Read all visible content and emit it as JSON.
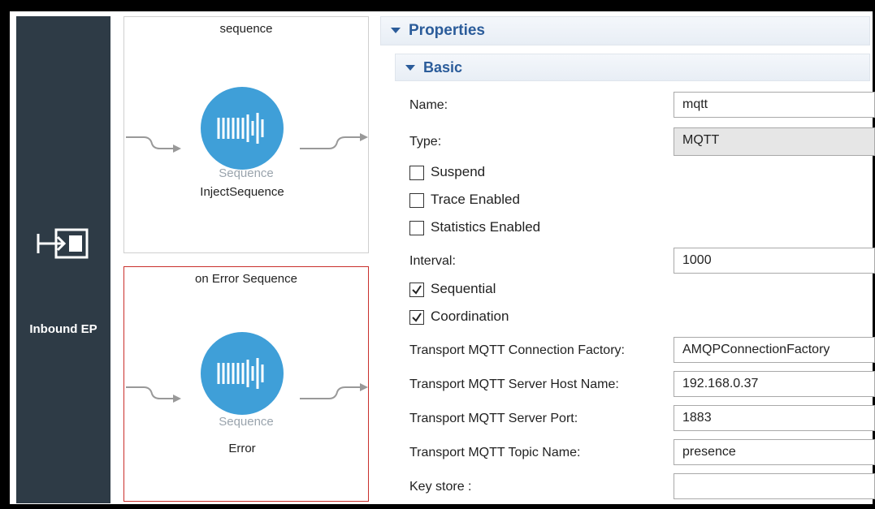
{
  "inbound": {
    "label": "Inbound EP",
    "icon": "inbound-endpoint-icon"
  },
  "sequence": {
    "title": "sequence",
    "type_label": "Sequence",
    "name": "InjectSequence",
    "icon": "sequence-icon"
  },
  "error_sequence": {
    "title": "on Error Sequence",
    "type_label": "Sequence",
    "name": "Error",
    "icon": "sequence-icon"
  },
  "properties": {
    "title": "Properties",
    "basic": {
      "title": "Basic"
    },
    "name": {
      "label": "Name:",
      "value": "mqtt"
    },
    "type": {
      "label": "Type:",
      "value": "MQTT"
    },
    "suspend": {
      "label": "Suspend",
      "checked": false
    },
    "trace": {
      "label": "Trace Enabled",
      "checked": false
    },
    "statistics": {
      "label": "Statistics Enabled",
      "checked": false
    },
    "interval": {
      "label": "Interval:",
      "value": "1000"
    },
    "sequential": {
      "label": "Sequential",
      "checked": true
    },
    "coordination": {
      "label": "Coordination",
      "checked": true
    },
    "connection_factory": {
      "label": "Transport MQTT Connection Factory:",
      "value": "AMQPConnectionFactory"
    },
    "server_host": {
      "label": "Transport MQTT Server Host Name:",
      "value": "192.168.0.37"
    },
    "server_port": {
      "label": "Transport MQTT Server Port:",
      "value": "1883"
    },
    "topic_name": {
      "label": "Transport MQTT Topic Name:",
      "value": "presence"
    },
    "key_store": {
      "label": "Key store :",
      "value": ""
    }
  },
  "colors": {
    "inbound_bg": "#2e3b46",
    "sequence_circle": "#3f9fd8",
    "section_title": "#2b5c9a",
    "error_border": "#c9302c"
  }
}
